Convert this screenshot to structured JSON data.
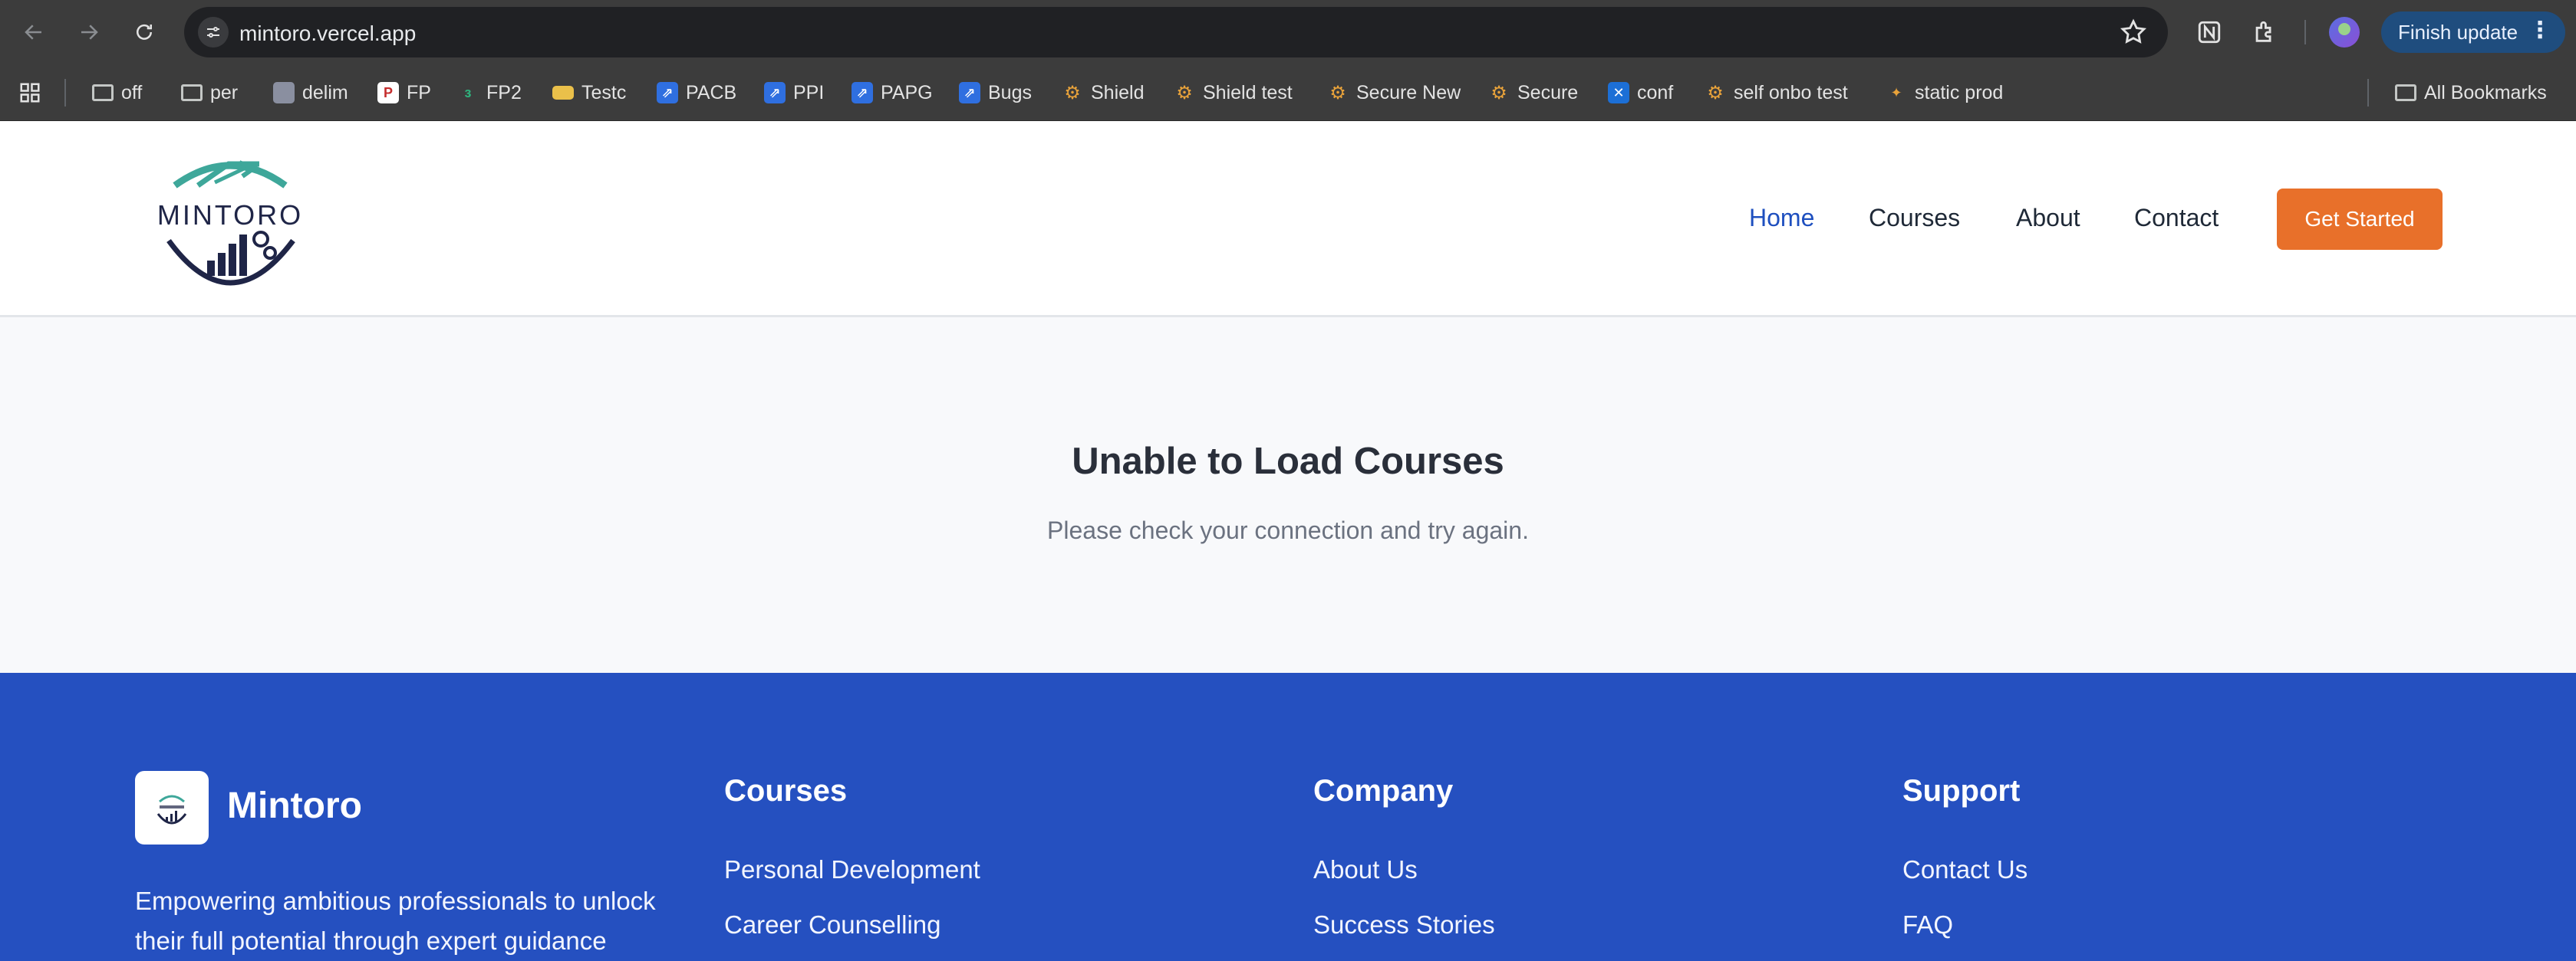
{
  "browser": {
    "url": "mintoro.vercel.app",
    "finish_update_label": "Finish update",
    "bookmarks": [
      {
        "label": "off",
        "icon": "folder-icon"
      },
      {
        "label": "per",
        "icon": "folder-icon"
      },
      {
        "label": "delim",
        "icon": "delim-icon"
      },
      {
        "label": "FP",
        "icon": "fp-icon"
      },
      {
        "label": "FP2",
        "icon": "fp2-icon"
      },
      {
        "label": "Testc",
        "icon": "card-icon"
      },
      {
        "label": "PACB",
        "icon": "jira-icon"
      },
      {
        "label": "PPI",
        "icon": "jira-icon"
      },
      {
        "label": "PAPG",
        "icon": "jira-icon"
      },
      {
        "label": "Bugs",
        "icon": "jira-icon"
      },
      {
        "label": "Shield",
        "icon": "shield-app-icon"
      },
      {
        "label": "Shield test",
        "icon": "shield-app-icon"
      },
      {
        "label": "Secure New",
        "icon": "shield-app-icon"
      },
      {
        "label": "Secure",
        "icon": "shield-app-icon"
      },
      {
        "label": "conf",
        "icon": "confluence-icon"
      },
      {
        "label": "self onbo test",
        "icon": "shield-app-icon"
      },
      {
        "label": "static prod",
        "icon": "shield-app-icon"
      }
    ],
    "all_bookmarks_label": "All Bookmarks"
  },
  "header": {
    "logo_text": "MINTORO",
    "nav": [
      "Home",
      "Courses",
      "About",
      "Contact"
    ],
    "cta_label": "Get Started",
    "accent": "#1e4fbf",
    "cta_color": "#e8702a"
  },
  "main": {
    "title": "Unable to Load Courses",
    "subtitle": "Please check your connection and try again."
  },
  "footer": {
    "brand_name": "Mintoro",
    "description": "Empowering ambitious professionals to unlock their full potential through expert guidance",
    "courses": {
      "heading": "Courses",
      "links": [
        "Personal Development",
        "Career Counselling"
      ]
    },
    "company": {
      "heading": "Company",
      "links": [
        "About Us",
        "Success Stories"
      ]
    },
    "support": {
      "heading": "Support",
      "links": [
        "Contact Us",
        "FAQ"
      ]
    },
    "background": "#2550c0"
  }
}
